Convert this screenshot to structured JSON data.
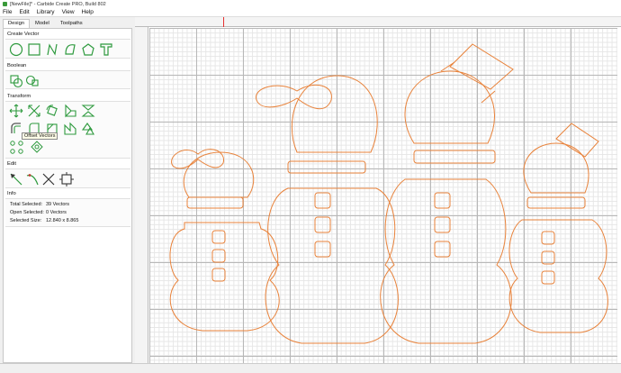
{
  "window": {
    "title": "[NewFile]* - Carbide Create PRO, Build 802"
  },
  "menu": [
    "File",
    "Edit",
    "Library",
    "View",
    "Help"
  ],
  "tabs": [
    "Design",
    "Model",
    "Toolpaths"
  ],
  "sections": {
    "create_vector": "Create Vector",
    "boolean": "Boolean",
    "transform": "Transform",
    "edit": "Edit",
    "info": "Info"
  },
  "tooltip": "Offset Vectors",
  "info": {
    "total_label": "Total Selected:",
    "total_value": "39 Vectors",
    "open_label": "Open Selected:",
    "open_value": "0 Vectors",
    "size_label": "Selected Size:",
    "size_value": "12.840 x 8.865"
  },
  "colors": {
    "accent": "#2e9a3e",
    "vector": "#e8823a",
    "marker": "#e53030"
  }
}
